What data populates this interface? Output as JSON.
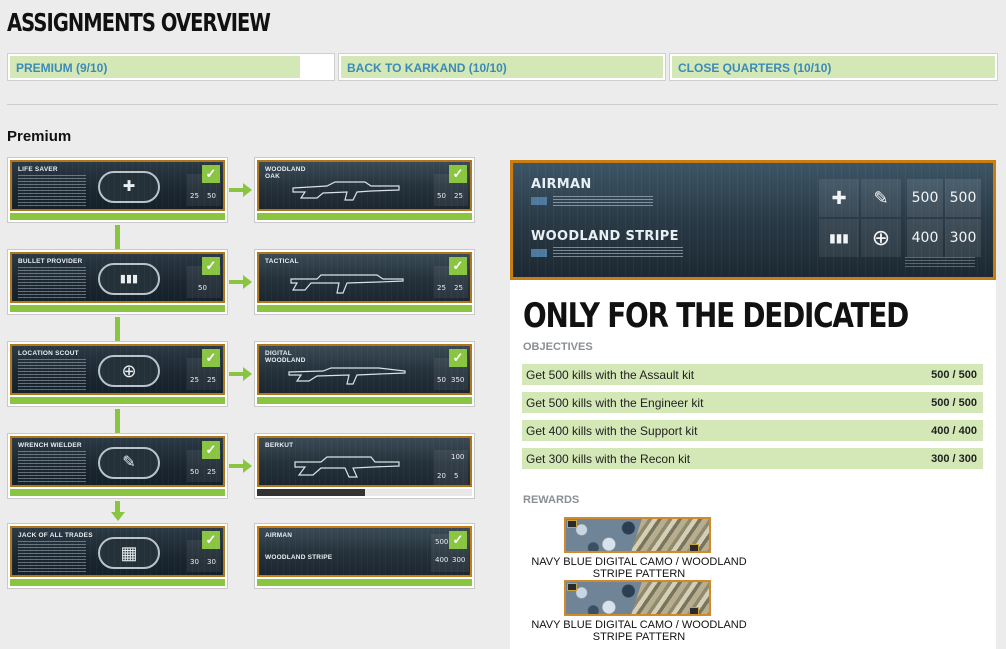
{
  "page": {
    "title": "ASSIGNMENTS OVERVIEW"
  },
  "tabs": [
    {
      "label": "PREMIUM (9/10)",
      "progress": 0.9
    },
    {
      "label": "BACK TO KARKAND (10/10)",
      "progress": 1.0
    },
    {
      "label": "CLOSE QUARTERS (10/10)",
      "progress": 1.0
    }
  ],
  "section": {
    "title": "Premium"
  },
  "assignments": [
    {
      "name": "LIFE SAVER",
      "icon": "plus-icon",
      "glyph": "✚",
      "stat_a": "25",
      "stat_b": "50",
      "completed": true
    },
    {
      "name": "BULLET PROVIDER",
      "icon": "ammo-icon",
      "glyph": "▮▮▮",
      "stat_a": "",
      "stat_b": "50",
      "completed": true
    },
    {
      "name": "LOCATION SCOUT",
      "icon": "crosshair-icon",
      "glyph": "⊕",
      "stat_a": "25",
      "stat_b": "25",
      "completed": true
    },
    {
      "name": "WRENCH WIELDER",
      "icon": "wrench-icon",
      "glyph": "🔧",
      "stat_a": "50",
      "stat_b": "25",
      "completed": true
    },
    {
      "name": "JACK OF ALL TRADES",
      "icon": "dogtags-icon",
      "glyph": "▦",
      "stat_a": "30",
      "stat_b": "30",
      "completed": true
    }
  ],
  "unlocks": [
    {
      "name": "WOODLAND OAK",
      "stat_a": "50",
      "stat_b": "25",
      "completed": true,
      "progress": 1.0
    },
    {
      "name": "TACTICAL",
      "stat_a": "25",
      "stat_b": "25",
      "completed": true,
      "progress": 1.0
    },
    {
      "name": "DIGITAL WOODLAND",
      "stat_a": "50",
      "stat_b": "350",
      "completed": true,
      "progress": 1.0
    },
    {
      "name": "BERKUT",
      "stat_a": "20",
      "stat_b": "100",
      "stat_c": "5",
      "completed": false,
      "progress": 0.5
    },
    {
      "name": "AIRMAN",
      "sub": "WOODLAND STRIPE",
      "stat_a": "500",
      "stat_b": "400",
      "stat_c": "300",
      "completed": true,
      "progress": 1.0
    }
  ],
  "detail": {
    "banner": {
      "name1": "AIRMAN",
      "name2": "WOODLAND STRIPE",
      "values": [
        "500",
        "500",
        "400",
        "300"
      ]
    },
    "headline": "ONLY FOR THE DEDICATED",
    "objectives_label": "OBJECTIVES",
    "objectives": [
      {
        "text": "Get 500 kills with the Assault kit",
        "value": "500 / 500"
      },
      {
        "text": "Get 500 kills with the Engineer kit",
        "value": "500 / 500"
      },
      {
        "text": "Get 400 kills with the Support kit",
        "value": "400 / 400"
      },
      {
        "text": "Get 300 kills with the Recon kit",
        "value": "300 / 300"
      }
    ],
    "rewards_label": "REWARDS",
    "rewards": [
      {
        "caption": "NAVY BLUE DIGITAL CAMO / WOODLAND STRIPE PATTERN"
      },
      {
        "caption": "NAVY BLUE DIGITAL CAMO / WOODLAND STRIPE PATTERN"
      }
    ]
  },
  "colors": {
    "accent_green": "#89c541",
    "tab_fill": "#d4e7b6",
    "tab_text": "#3b8bb8",
    "frame_orange": "#c77d12"
  }
}
